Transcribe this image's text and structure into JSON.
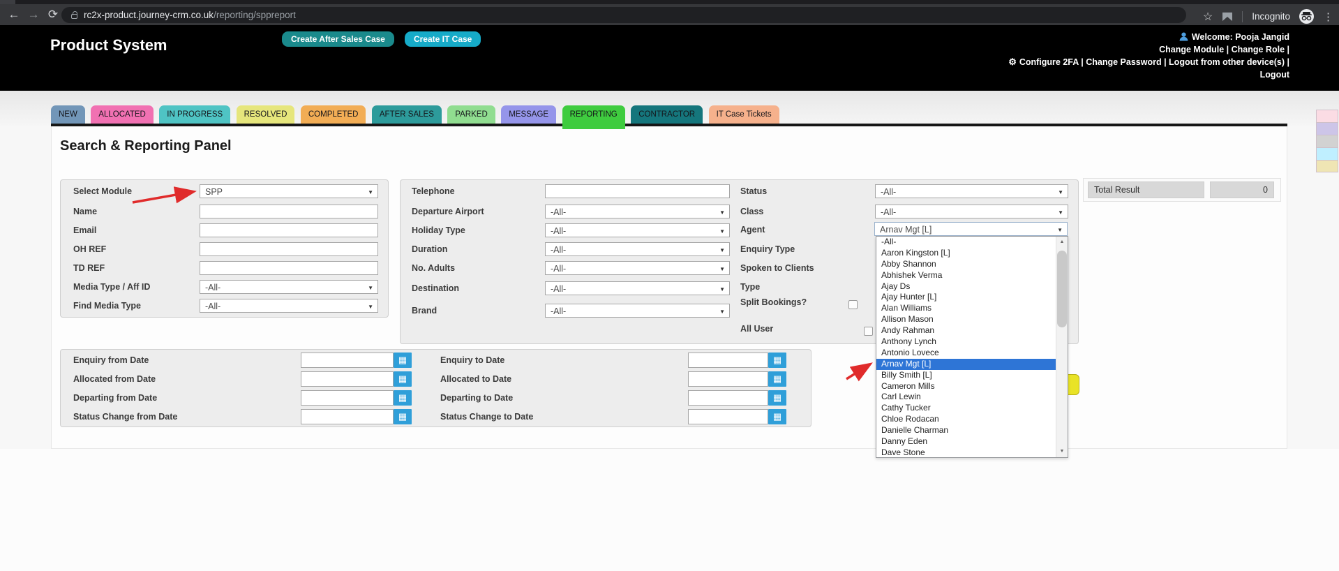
{
  "browser": {
    "host": "rc2x-product.journey-crm.co.uk",
    "path": "/reporting/sppreport",
    "incognito": "Incognito"
  },
  "header": {
    "title": "Product System",
    "actions": [
      {
        "label": "Create After Sales Case",
        "color": "#1a8a8c"
      },
      {
        "label": "Create IT Case",
        "color": "#16abc8"
      }
    ],
    "user": {
      "welcome": "Welcome: Pooja Jangid",
      "links_line1": "Change Module | Change Role |",
      "links_line2": "Configure 2FA | Change Password | Logout from other device(s) |",
      "logout": "Logout"
    }
  },
  "tabs": [
    {
      "label": "NEW",
      "color": "#7296b8"
    },
    {
      "label": "ALLOCATED",
      "color": "#f171b2"
    },
    {
      "label": "IN PROGRESS",
      "color": "#4fc4c4"
    },
    {
      "label": "RESOLVED",
      "color": "#e6e67c"
    },
    {
      "label": "COMPLETED",
      "color": "#f2ad55"
    },
    {
      "label": "AFTER SALES",
      "color": "#2d9b9b"
    },
    {
      "label": "PARKED",
      "color": "#90dd90"
    },
    {
      "label": "MESSAGE",
      "color": "#9595ea"
    },
    {
      "label": "REPORTING",
      "color": "#3fcc3f",
      "active": true
    },
    {
      "label": "CONTRACTOR",
      "color": "#15767c"
    },
    {
      "label": "IT Case Tickets",
      "color": "#f6b18c"
    }
  ],
  "panel": {
    "title": "Search & Reporting Panel",
    "left_fields": [
      {
        "label": "Select Module",
        "type": "select",
        "value": "SPP"
      },
      {
        "label": "Name",
        "type": "input",
        "value": ""
      },
      {
        "label": "Email",
        "type": "input",
        "value": ""
      },
      {
        "label": "OH REF",
        "type": "input",
        "value": ""
      },
      {
        "label": "TD REF",
        "type": "input",
        "value": ""
      },
      {
        "label": "Media Type / Aff ID",
        "type": "select",
        "value": "-All-"
      },
      {
        "label": "Find Media Type",
        "type": "select",
        "value": "-All-"
      }
    ],
    "middle_fields": [
      {
        "label": "Telephone",
        "type": "input",
        "value": ""
      },
      {
        "label": "Departure Airport",
        "type": "select",
        "value": "-All-"
      },
      {
        "label": "Holiday Type",
        "type": "select",
        "value": "-All-"
      },
      {
        "label": "Duration",
        "type": "select",
        "value": "-All-"
      },
      {
        "label": "No. Adults",
        "type": "select",
        "value": "-All-"
      },
      {
        "label": "Destination",
        "type": "select",
        "value": "-All-"
      },
      {
        "label": "Brand",
        "type": "select",
        "value": "-All-"
      }
    ],
    "right_fields": {
      "status": {
        "label": "Status",
        "value": "-All-"
      },
      "class": {
        "label": "Class",
        "value": "-All-"
      },
      "agent": {
        "label": "Agent",
        "value": "Arnav Mgt [L]"
      },
      "enquiry_type": {
        "label": "Enquiry Type"
      },
      "spoken": {
        "label": "Spoken to Clients"
      },
      "type": {
        "label": "Type"
      },
      "split": {
        "label": "Split Bookings?"
      },
      "all_user": {
        "label": "All User"
      }
    },
    "total_result": {
      "label": "Total Result",
      "value": "0"
    },
    "dates": [
      {
        "left": "Enquiry from Date",
        "right": "Enquiry to Date"
      },
      {
        "left": "Allocated from Date",
        "right": "Allocated to Date"
      },
      {
        "left": "Departing from Date",
        "right": "Departing to Date"
      },
      {
        "left": "Status Change from Date",
        "right": "Status Change to Date"
      }
    ]
  },
  "agent_dropdown": {
    "selected": "Arnav Mgt [L]",
    "highlight_color": "#2e75d6",
    "options": [
      "-All-",
      "Aaron Kingston [L]",
      "Abby Shannon",
      "Abhishek Verma",
      "Ajay Ds",
      "Ajay Hunter [L]",
      "Alan Williams",
      "Allison Mason",
      "Andy Rahman",
      "Anthony Lynch",
      "Antonio Lovece",
      "Arnav Mgt [L]",
      "Billy Smith [L]",
      "Cameron Mills",
      "Carl Lewin",
      "Cathy Tucker",
      "Chloe Rodacan",
      "Danielle Charman",
      "Danny Eden",
      "Dave Stone"
    ]
  },
  "legend": {
    "colors": [
      "#fbdce4",
      "#cdc5e8",
      "#d2d2d2",
      "#bfefff",
      "#efe5b4"
    ]
  },
  "annotations": {
    "arrow_color": "#e02b2b"
  }
}
